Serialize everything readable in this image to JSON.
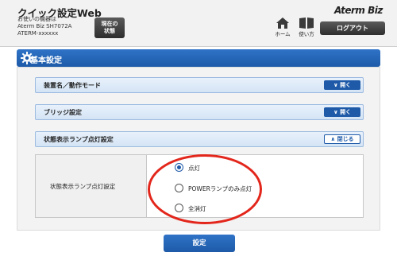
{
  "header": {
    "app_title": "クイック設定Web",
    "device_lines": [
      "お使いの機器は",
      "Aterm Biz SH7072A",
      "ATERM-xxxxxx"
    ],
    "status_button": [
      "現在の",
      "状態"
    ],
    "brand": "Aterm Biz",
    "home_label": "ホーム",
    "help_label": "使い方",
    "logout_label": "ログアウト"
  },
  "page": {
    "section_title": "基本設定"
  },
  "accordions": [
    {
      "label": "装置名／動作モード",
      "button": "開く",
      "state": "collapsed"
    },
    {
      "label": "ブリッジ設定",
      "button": "開く",
      "state": "collapsed"
    },
    {
      "label": "状態表示ランプ点灯設定",
      "button": "閉じる",
      "state": "expanded"
    }
  ],
  "lamp_setting": {
    "row_label": "状態表示ランプ点灯設定",
    "options": [
      "点灯",
      "POWERランプのみ点灯",
      "全消灯"
    ],
    "selected": "点灯"
  },
  "submit_label": "設定",
  "colors": {
    "accent": "#1e5aa8",
    "highlight": "#e3261b"
  }
}
